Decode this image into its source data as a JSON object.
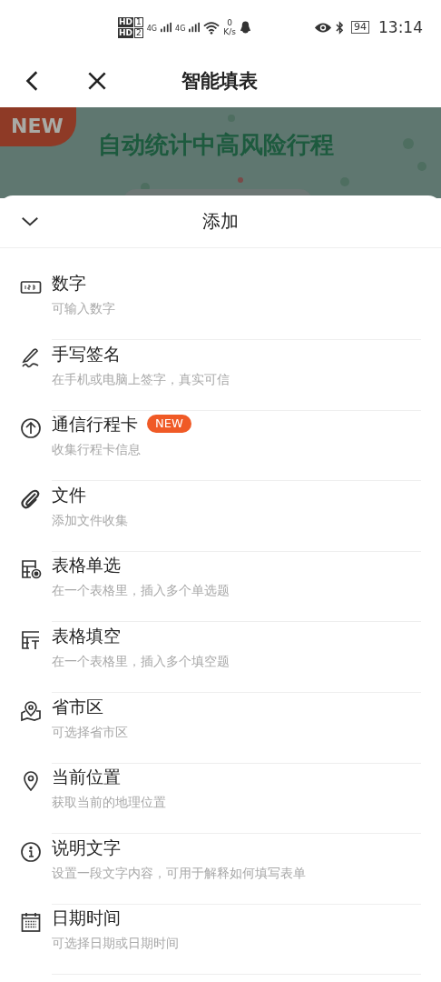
{
  "status_bar": {
    "sims": [
      {
        "hd": "HD",
        "slot": "1",
        "network": "4G"
      },
      {
        "hd": "HD",
        "slot": "2",
        "network": "4G"
      }
    ],
    "speed_value": "0",
    "speed_unit": "K/s",
    "battery": "94",
    "time": "13:14"
  },
  "nav": {
    "title": "智能填表"
  },
  "banner": {
    "tag": "NEW",
    "headline": "自动统计中高风险行程"
  },
  "sheet": {
    "title": "添加",
    "items": [
      {
        "kind": "number",
        "title": "数字",
        "subtitle": "可输入数字"
      },
      {
        "kind": "signature",
        "title": "手写签名",
        "subtitle": "在手机或电脑上签字，真实可信"
      },
      {
        "kind": "upload",
        "title": "通信行程卡",
        "badge": "NEW",
        "subtitle": "收集行程卡信息"
      },
      {
        "kind": "attach",
        "title": "文件",
        "subtitle": "添加文件收集"
      },
      {
        "kind": "table-radio",
        "title": "表格单选",
        "subtitle": "在一个表格里，插入多个单选题"
      },
      {
        "kind": "table-fill",
        "title": "表格填空",
        "subtitle": "在一个表格里，插入多个填空题"
      },
      {
        "kind": "region",
        "title": "省市区",
        "subtitle": "可选择省市区"
      },
      {
        "kind": "location",
        "title": "当前位置",
        "subtitle": "获取当前的地理位置"
      },
      {
        "kind": "info",
        "title": "说明文字",
        "subtitle": "设置一段文字内容，可用于解释如何填写表单"
      },
      {
        "kind": "calendar",
        "title": "日期时间",
        "subtitle": "可选择日期或日期时间"
      }
    ]
  }
}
